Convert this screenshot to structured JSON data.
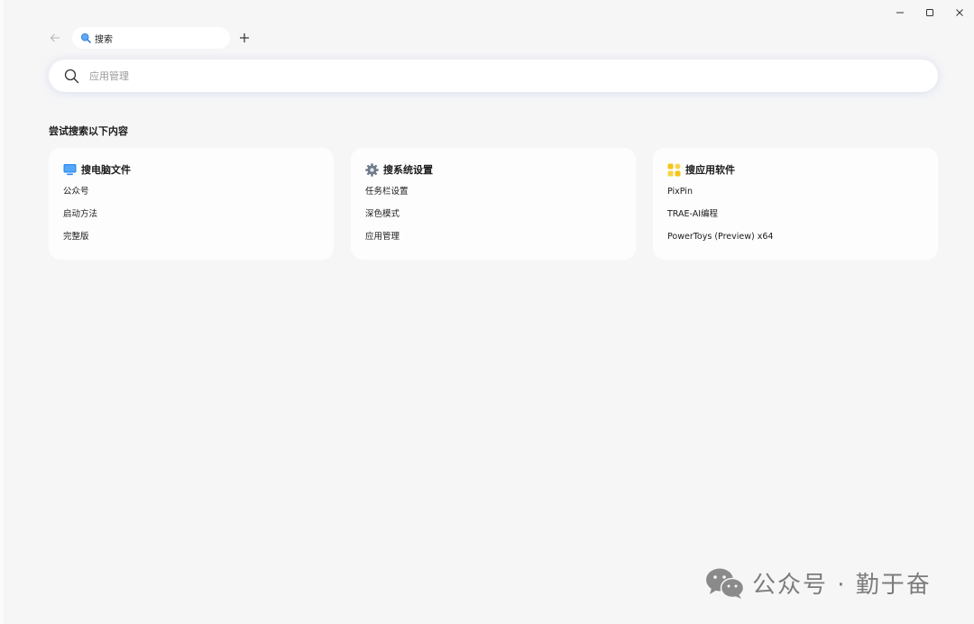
{
  "window": {
    "controls": {
      "minimize_icon": "minimize-icon",
      "maximize_icon": "maximize-icon",
      "close_icon": "close-icon"
    }
  },
  "tabs": {
    "back_icon": "back-arrow-icon",
    "active_tab": {
      "label": "搜索",
      "icon": "search-tab-icon"
    },
    "new_tab_icon": "plus-icon"
  },
  "search": {
    "placeholder": "应用管理",
    "value": ""
  },
  "suggestions": {
    "heading": "尝试搜索以下内容",
    "cards": [
      {
        "title": "搜电脑文件",
        "icon": "computer-icon",
        "items": [
          "公众号",
          "启动方法",
          "完整版"
        ]
      },
      {
        "title": "搜系统设置",
        "icon": "gear-icon",
        "items": [
          "任务栏设置",
          "深色模式",
          "应用管理"
        ]
      },
      {
        "title": "搜应用软件",
        "icon": "apps-icon",
        "items": [
          "PixPin",
          "TRAE-AI编程",
          "PowerToys (Preview) x64"
        ]
      }
    ]
  },
  "watermark": {
    "text": "公众号 · 勤于奋",
    "icon": "wechat-logo"
  },
  "colors": {
    "background": "#f6f6f7",
    "card": "#fdfdfd",
    "computer_icon": "#2f8cf0",
    "gear_icon": "#6e7a8a",
    "apps_icon": "#f5c518"
  }
}
